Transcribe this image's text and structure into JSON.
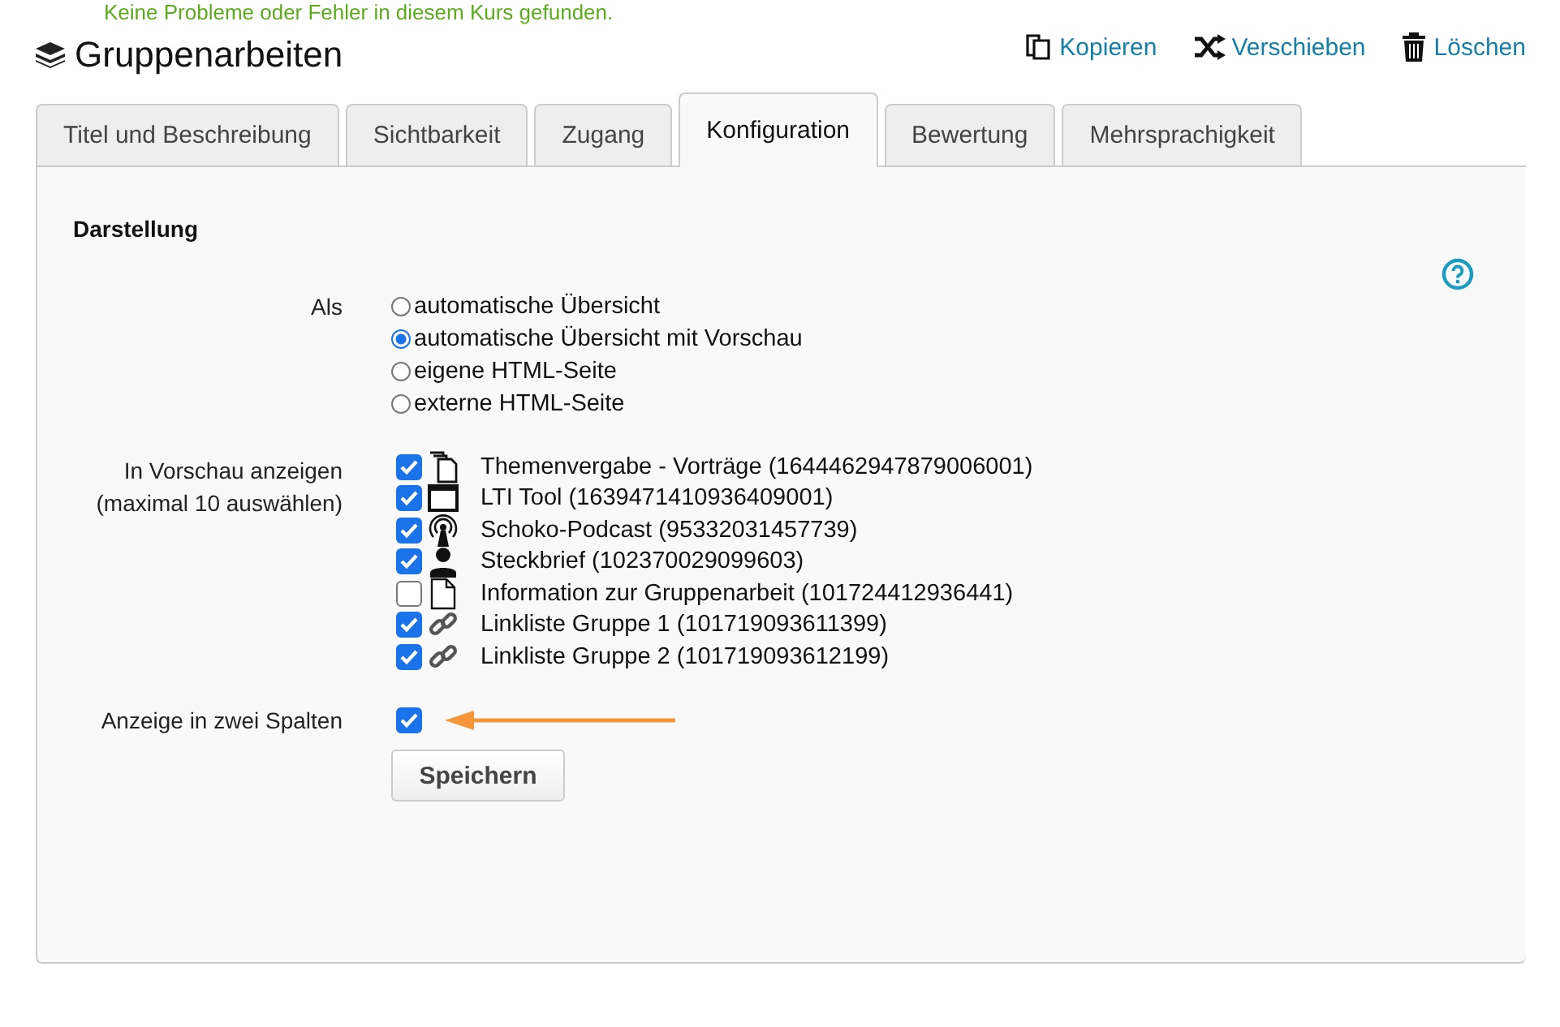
{
  "notice": {
    "text": "Keine Probleme oder Fehler in diesem Kurs gefunden."
  },
  "header": {
    "title": "Gruppenarbeiten",
    "actions": [
      {
        "kind": "copy",
        "label": "Kopieren"
      },
      {
        "kind": "move",
        "label": "Verschieben"
      },
      {
        "kind": "delete",
        "label": "Löschen"
      }
    ]
  },
  "tabs": [
    {
      "label": "Titel und Beschreibung",
      "selected": false
    },
    {
      "label": "Sichtbarkeit",
      "selected": false
    },
    {
      "label": "Zugang",
      "selected": false
    },
    {
      "label": "Konfiguration",
      "selected": true
    },
    {
      "label": "Bewertung",
      "selected": false
    },
    {
      "label": "Mehrsprachigkeit",
      "selected": false
    }
  ],
  "section": {
    "title": "Darstellung"
  },
  "display_as": {
    "label": "Als",
    "options": [
      {
        "label": "automatische Übersicht",
        "selected": false
      },
      {
        "label": "automatische Übersicht mit Vorschau",
        "selected": true
      },
      {
        "label": "eigene HTML-Seite",
        "selected": false
      },
      {
        "label": "externe HTML-Seite",
        "selected": false
      }
    ]
  },
  "preview": {
    "label_lines": [
      "In Vorschau anzeigen",
      "(maximal 10 auswählen)"
    ],
    "items": [
      {
        "kind": "pages",
        "label": "Themenvergabe - Vorträge (1644462947879006001)",
        "checked": true
      },
      {
        "kind": "window",
        "label": "LTI Tool (1639471410936409001)",
        "checked": true
      },
      {
        "kind": "podcast",
        "label": "Schoko-Podcast (95332031457739)",
        "checked": true
      },
      {
        "kind": "person",
        "label": "Steckbrief (102370029099603)",
        "checked": true
      },
      {
        "kind": "page",
        "label": "Information zur Gruppenarbeit (101724412936441)",
        "checked": false
      },
      {
        "kind": "link",
        "label": "Linkliste Gruppe 1 (101719093611399)",
        "checked": true
      },
      {
        "kind": "link",
        "label": "Linkliste Gruppe 2 (101719093612199)",
        "checked": true
      }
    ]
  },
  "two_columns": {
    "label": "Anzeige in zwei Spalten",
    "checked": true
  },
  "save_button": {
    "label": "Speichern"
  }
}
